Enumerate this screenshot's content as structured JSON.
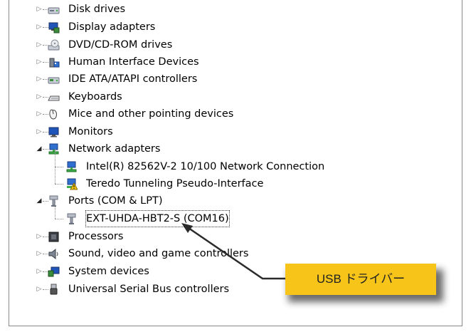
{
  "tree": {
    "items": [
      {
        "label": "Disk drives",
        "icon": "disk-drive-icon"
      },
      {
        "label": "Display adapters",
        "icon": "display-adapter-icon"
      },
      {
        "label": "DVD/CD-ROM drives",
        "icon": "dvd-drive-icon"
      },
      {
        "label": "Human Interface Devices",
        "icon": "hid-icon"
      },
      {
        "label": "IDE ATA/ATAPI controllers",
        "icon": "ide-controller-icon"
      },
      {
        "label": "Keyboards",
        "icon": "keyboard-icon"
      },
      {
        "label": "Mice and other pointing devices",
        "icon": "mouse-icon"
      },
      {
        "label": "Monitors",
        "icon": "monitor-icon"
      },
      {
        "label": "Network adapters",
        "icon": "network-adapter-icon"
      },
      {
        "label": "Intel(R) 82562V-2 10/100 Network Connection",
        "icon": "network-card-icon"
      },
      {
        "label": "Teredo Tunneling Pseudo-Interface",
        "icon": "network-warning-icon"
      },
      {
        "label": "Ports (COM & LPT)",
        "icon": "port-icon"
      },
      {
        "label": "EXT-UHDA-HBT2-S (COM16)",
        "icon": "port-icon"
      },
      {
        "label": "Processors",
        "icon": "processor-icon"
      },
      {
        "label": "Sound, video and game controllers",
        "icon": "speaker-icon"
      },
      {
        "label": "System devices",
        "icon": "system-device-icon"
      },
      {
        "label": "Universal Serial Bus controllers",
        "icon": "usb-icon"
      }
    ]
  },
  "callout": {
    "label": "USB ドライバー",
    "color": "#f7c51a",
    "arrow_color": "#2b2b2b"
  }
}
